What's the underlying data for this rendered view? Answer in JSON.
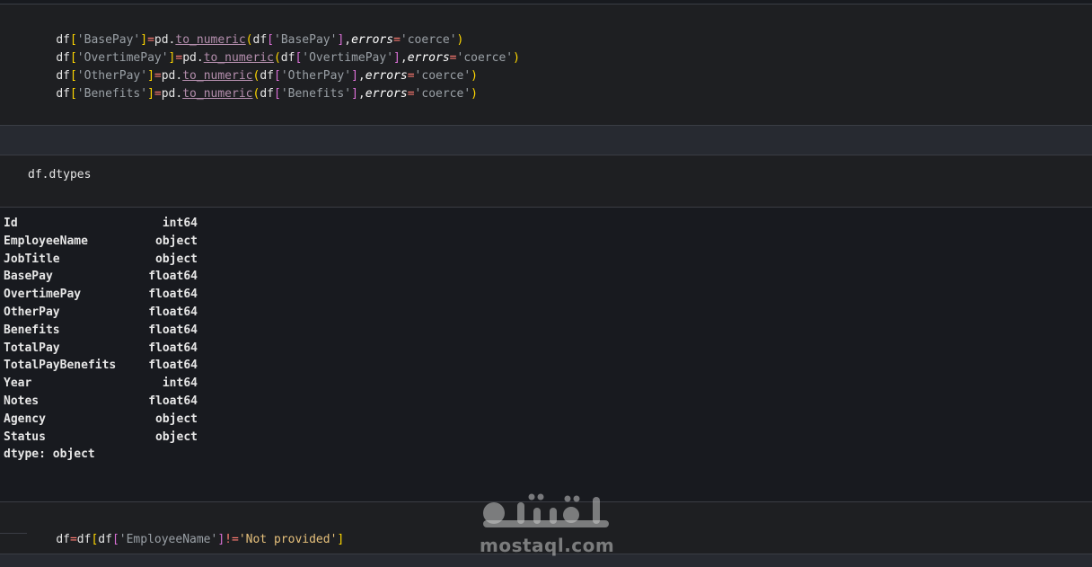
{
  "cell1": {
    "lines": [
      {
        "c": "df[",
        "b": "'",
        "s": "BasePay",
        "e": "']=pd.",
        "fn": "to_numeric",
        "a": "(df['",
        "s2": "BasePay",
        "t": "'],",
        "kw": "errors",
        "eq": "='",
        "v": "coerce",
        "end": "')"
      },
      {
        "c": "df[",
        "b": "'",
        "s": "OvertimePay",
        "e": "']=pd.",
        "fn": "to_numeric",
        "a": "(df['",
        "s2": "OvertimePay",
        "t": "'],",
        "kw": "errors",
        "eq": "='",
        "v": "coerce",
        "end": "')"
      },
      {
        "c": "df[",
        "b": "'",
        "s": "OtherPay",
        "e": "']=pd.",
        "fn": "to_numeric",
        "a": "(df['",
        "s2": "OtherPay",
        "t": "'],",
        "kw": "errors",
        "eq": "='",
        "v": "coerce",
        "end": "')"
      },
      {
        "c": "df[",
        "b": "'",
        "s": "Benefits",
        "e": "']=pd.",
        "fn": "to_numeric",
        "a": "(df['",
        "s2": "Benefits",
        "t": "'],",
        "kw": "errors",
        "eq": "='",
        "v": "coerce",
        "end": "')"
      }
    ]
  },
  "cell2": {
    "code": "df.dtypes"
  },
  "output": {
    "rows": [
      {
        "name": "Id",
        "type": "int64"
      },
      {
        "name": "EmployeeName",
        "type": "object"
      },
      {
        "name": "JobTitle",
        "type": "object"
      },
      {
        "name": "BasePay",
        "type": "float64"
      },
      {
        "name": "OvertimePay",
        "type": "float64"
      },
      {
        "name": "OtherPay",
        "type": "float64"
      },
      {
        "name": "Benefits",
        "type": "float64"
      },
      {
        "name": "TotalPay",
        "type": "float64"
      },
      {
        "name": "TotalPayBenefits",
        "type": "float64"
      },
      {
        "name": "Year",
        "type": "int64"
      },
      {
        "name": "Notes",
        "type": "float64"
      },
      {
        "name": "Agency",
        "type": "object"
      },
      {
        "name": "Status",
        "type": "object"
      }
    ],
    "footer": "dtype: object"
  },
  "cell3": {
    "p1": "df",
    "p2": "=",
    "p3": "df",
    "p4": "[",
    "p5": "df",
    "p6": "[",
    "p7": "'EmployeeName'",
    "p8": "]",
    "p9": "!=",
    "p10": "'Not provided'",
    "p11": "]"
  },
  "watermark": {
    "arabic": "مستقل",
    "latin": "mostaql.com"
  }
}
